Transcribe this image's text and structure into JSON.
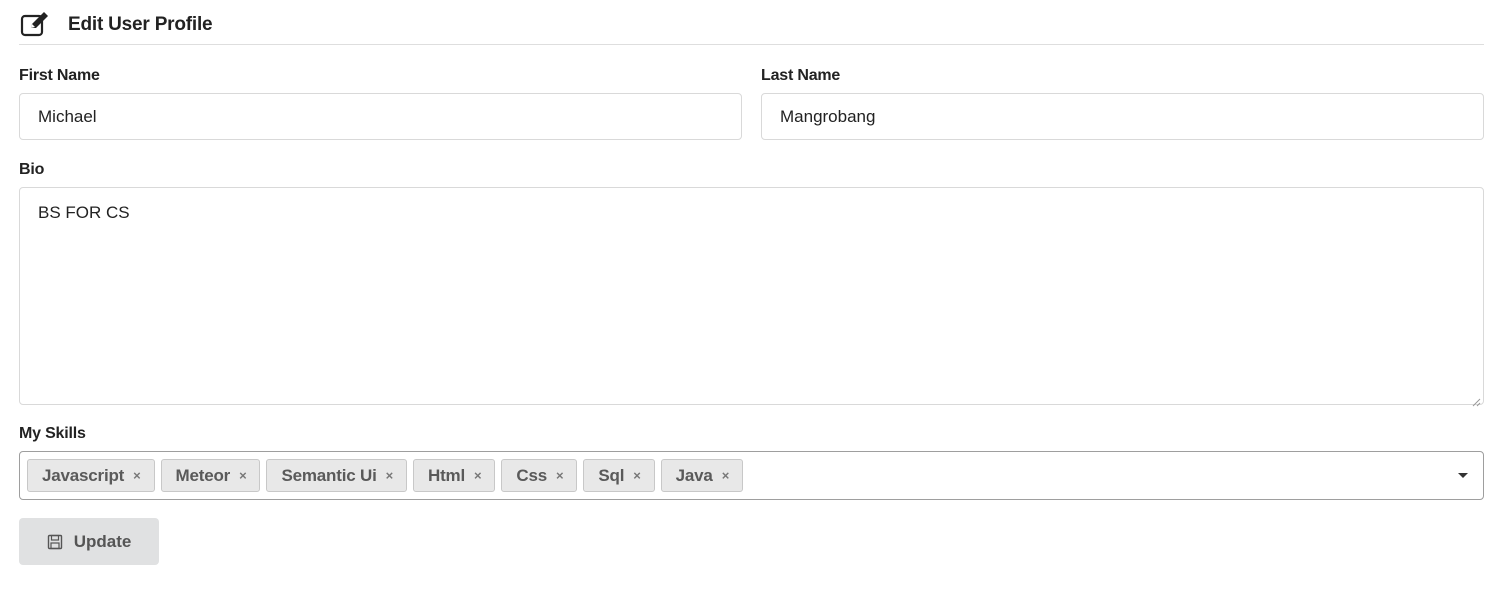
{
  "header": {
    "title": "Edit User Profile",
    "icon": "edit-icon"
  },
  "form": {
    "first_name": {
      "label": "First Name",
      "value": "Michael"
    },
    "last_name": {
      "label": "Last Name",
      "value": "Mangrobang"
    },
    "bio": {
      "label": "Bio",
      "value": "BS FOR CS"
    },
    "skills": {
      "label": "My Skills",
      "selected": [
        "Javascript",
        "Meteor",
        "Semantic Ui",
        "Html",
        "Css",
        "Sql",
        "Java"
      ],
      "remove_icon": "×",
      "dropdown_icon": "caret-down-icon"
    },
    "submit": {
      "label": "Update",
      "icon": "save-icon"
    }
  }
}
